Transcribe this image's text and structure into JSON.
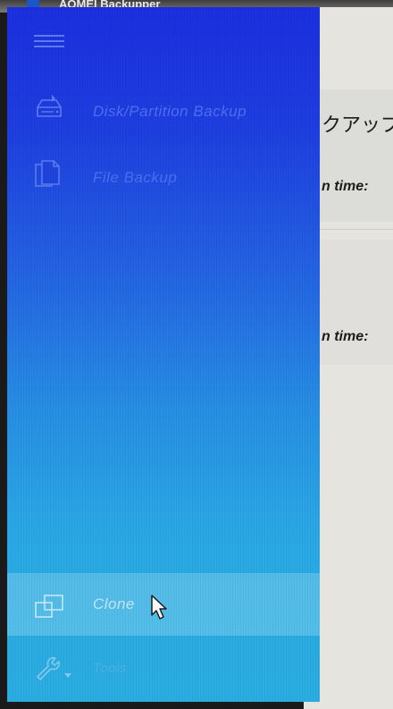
{
  "window": {
    "title": "AOMEI Backupper"
  },
  "sidebar": {
    "menu_icon": "hamburger-menu-icon",
    "items": [
      {
        "id": "disk-partition-backup",
        "label": "Disk/Partition Backup",
        "icon": "disk-icon"
      },
      {
        "id": "file-backup",
        "label": "File Backup",
        "icon": "file-icon"
      },
      {
        "id": "clone",
        "label": "Clone",
        "icon": "clone-icon",
        "state": "hovered"
      },
      {
        "id": "tools",
        "label": "Tools",
        "icon": "wrench-icon"
      }
    ]
  },
  "content": {
    "heading_fragment": "クアップ",
    "row1_fragment": "n time:",
    "row2_fragment": "n time:"
  },
  "colors": {
    "drawer_top": "#1b2fe0",
    "drawer_bottom": "#2db4e8",
    "content_bg": "#e5e4df"
  }
}
